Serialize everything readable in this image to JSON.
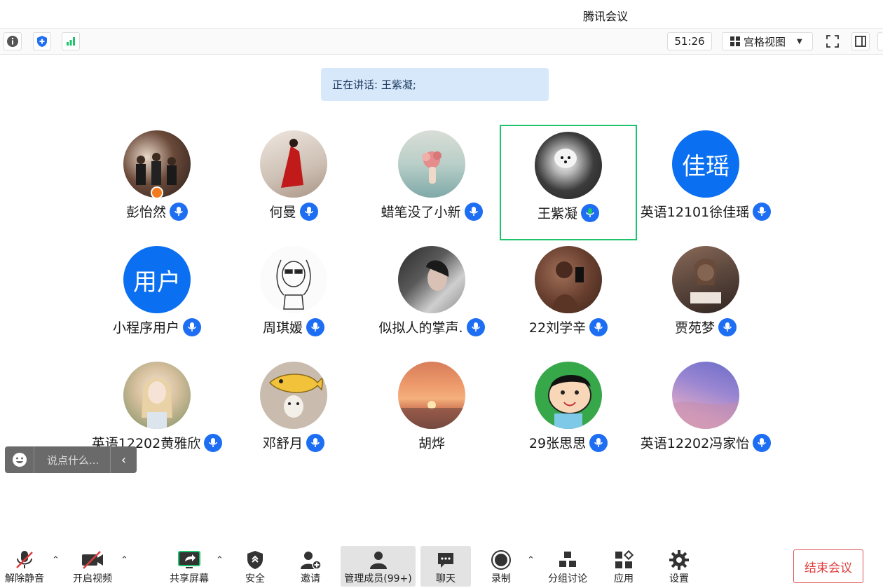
{
  "window": {
    "title": "腾讯会议"
  },
  "topbar": {
    "timer": "51:26",
    "view_label": "宫格视图"
  },
  "speaking": {
    "text": "正在讲话: 王紫凝;"
  },
  "colors": {
    "active_border": "#1fc36b",
    "mic_idle": "#1d6ef2",
    "mic_speaking": "#1fc36b",
    "avatar_text_bg": "#0a6ff0",
    "end_button": "#e03c3c"
  },
  "participants": [
    {
      "name": "彭怡然",
      "mic": "idle",
      "avatar": "photo"
    },
    {
      "name": "何曼",
      "mic": "idle",
      "avatar": "photo"
    },
    {
      "name": "蜡笔没了小新",
      "mic": "idle",
      "avatar": "photo"
    },
    {
      "name": "王紫凝",
      "mic": "speaking",
      "avatar": "photo"
    },
    {
      "name": "英语12101徐佳瑶",
      "mic": "idle",
      "avatar": "text",
      "avatar_text": "佳瑶"
    },
    {
      "name": "小程序用户",
      "mic": "idle",
      "avatar": "text",
      "avatar_text": "用户"
    },
    {
      "name": "周琪媛",
      "mic": "idle",
      "avatar": "photo"
    },
    {
      "name": "似拟人的掌声.",
      "mic": "idle",
      "avatar": "photo"
    },
    {
      "name": "22刘学辛",
      "mic": "idle",
      "avatar": "photo"
    },
    {
      "name": "贾苑梦",
      "mic": "idle",
      "avatar": "photo"
    },
    {
      "name": "英语12202黄雅欣",
      "mic": "idle",
      "avatar": "photo"
    },
    {
      "name": "邓舒月",
      "mic": "idle",
      "avatar": "photo"
    },
    {
      "name": "胡烨",
      "mic": "none",
      "avatar": "photo"
    },
    {
      "name": "29张思思",
      "mic": "idle",
      "avatar": "photo"
    },
    {
      "name": "英语12202冯家怡",
      "mic": "idle",
      "avatar": "photo"
    }
  ],
  "chat": {
    "placeholder": "说点什么..."
  },
  "toolbar": {
    "unmute": "解除静音",
    "start_video": "开启视频",
    "share_screen": "共享屏幕",
    "security": "安全",
    "invite": "邀请",
    "manage_members": "管理成员(99+)",
    "chat": "聊天",
    "record": "录制",
    "breakout": "分组讨论",
    "apps": "应用",
    "settings": "设置",
    "end_meeting": "结束会议"
  }
}
